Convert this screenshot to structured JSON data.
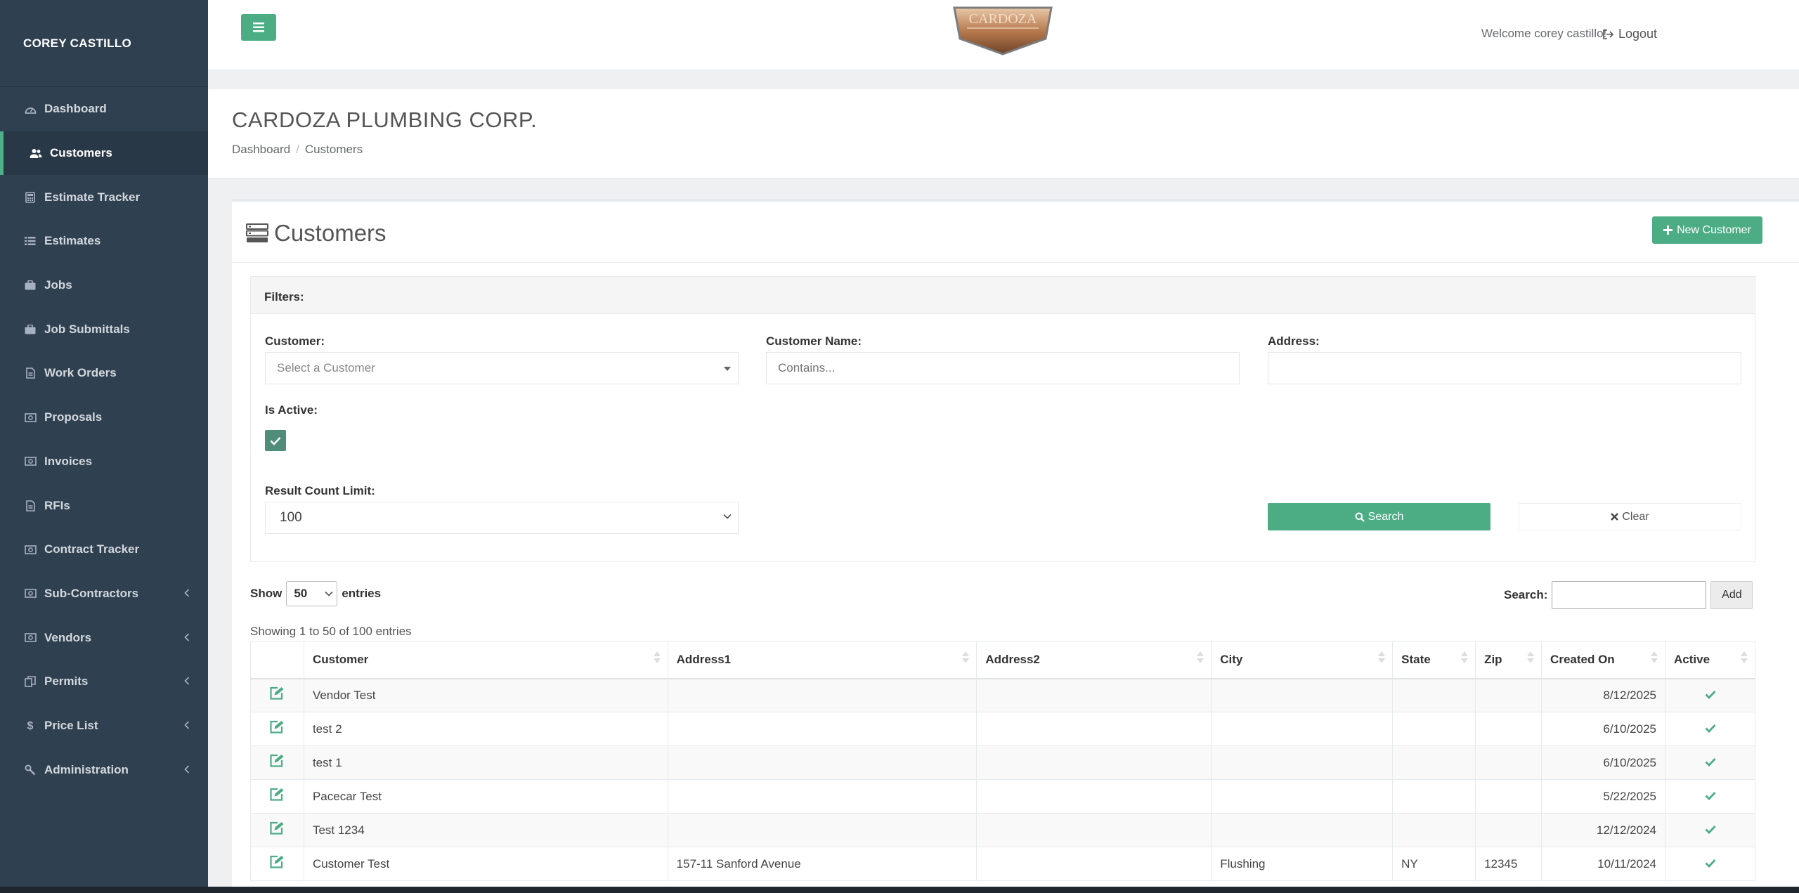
{
  "sidebar": {
    "user": "COREY CASTILLO",
    "items": [
      {
        "label": "Dashboard",
        "icon": "dashboard-icon"
      },
      {
        "label": "Customers",
        "icon": "users-icon"
      },
      {
        "label": "Estimate Tracker",
        "icon": "calculator-icon"
      },
      {
        "label": "Estimates",
        "icon": "list-icon"
      },
      {
        "label": "Jobs",
        "icon": "briefcase-icon"
      },
      {
        "label": "Job Submittals",
        "icon": "briefcase-icon"
      },
      {
        "label": "Work Orders",
        "icon": "file-icon"
      },
      {
        "label": "Proposals",
        "icon": "money-icon"
      },
      {
        "label": "Invoices",
        "icon": "money-icon"
      },
      {
        "label": "RFIs",
        "icon": "file-icon"
      },
      {
        "label": "Contract Tracker",
        "icon": "money-icon"
      },
      {
        "label": "Sub-Contractors",
        "icon": "money-icon"
      },
      {
        "label": "Vendors",
        "icon": "money-icon"
      },
      {
        "label": "Permits",
        "icon": "copy-icon"
      },
      {
        "label": "Price List",
        "icon": "dollar-icon"
      },
      {
        "label": "Administration",
        "icon": "wrench-icon"
      }
    ]
  },
  "header": {
    "welcome": "Welcome corey castillo!",
    "logout": "Logout",
    "logo_text": "CARDOZA"
  },
  "page": {
    "company": "CARDOZA PLUMBING CORP.",
    "breadcrumb": [
      "Dashboard",
      "Customers"
    ]
  },
  "panel": {
    "title": "Customers",
    "new_button": "New Customer"
  },
  "filters": {
    "heading": "Filters:",
    "customer_label": "Customer:",
    "customer_placeholder": "Select a Customer",
    "name_label": "Customer Name:",
    "name_placeholder": "Contains...",
    "address_label": "Address:",
    "active_label": "Is Active:",
    "limit_label": "Result Count Limit:",
    "limit_value": "100",
    "search_button": "Search",
    "clear_button": "Clear"
  },
  "table_controls": {
    "show": "Show",
    "entries_value": "50",
    "entries": "entries",
    "search_label": "Search:",
    "add_button": "Add",
    "showing": "Showing 1 to 50 of 100 entries"
  },
  "table": {
    "columns": [
      "Customer",
      "Address1",
      "Address2",
      "City",
      "State",
      "Zip",
      "Created On",
      "Active"
    ],
    "rows": [
      {
        "customer": "Vendor Test",
        "address1": "",
        "address2": "",
        "city": "",
        "state": "",
        "zip": "",
        "created": "8/12/2025"
      },
      {
        "customer": "test 2",
        "address1": "",
        "address2": "",
        "city": "",
        "state": "",
        "zip": "",
        "created": "6/10/2025"
      },
      {
        "customer": "test 1",
        "address1": "",
        "address2": "",
        "city": "",
        "state": "",
        "zip": "",
        "created": "6/10/2025"
      },
      {
        "customer": "Pacecar Test",
        "address1": "",
        "address2": "",
        "city": "",
        "state": "",
        "zip": "",
        "created": "5/22/2025"
      },
      {
        "customer": "Test 1234",
        "address1": "",
        "address2": "",
        "city": "",
        "state": "",
        "zip": "",
        "created": "12/12/2024"
      },
      {
        "customer": "Customer Test",
        "address1": "157-11 Sanford Avenue",
        "address2": "",
        "city": "Flushing",
        "state": "NY",
        "zip": "12345",
        "created": "10/11/2024"
      }
    ]
  },
  "colors": {
    "sidebar_bg": "#2f4050",
    "accent": "#4cad85",
    "checkbox": "#4f8d7a"
  }
}
